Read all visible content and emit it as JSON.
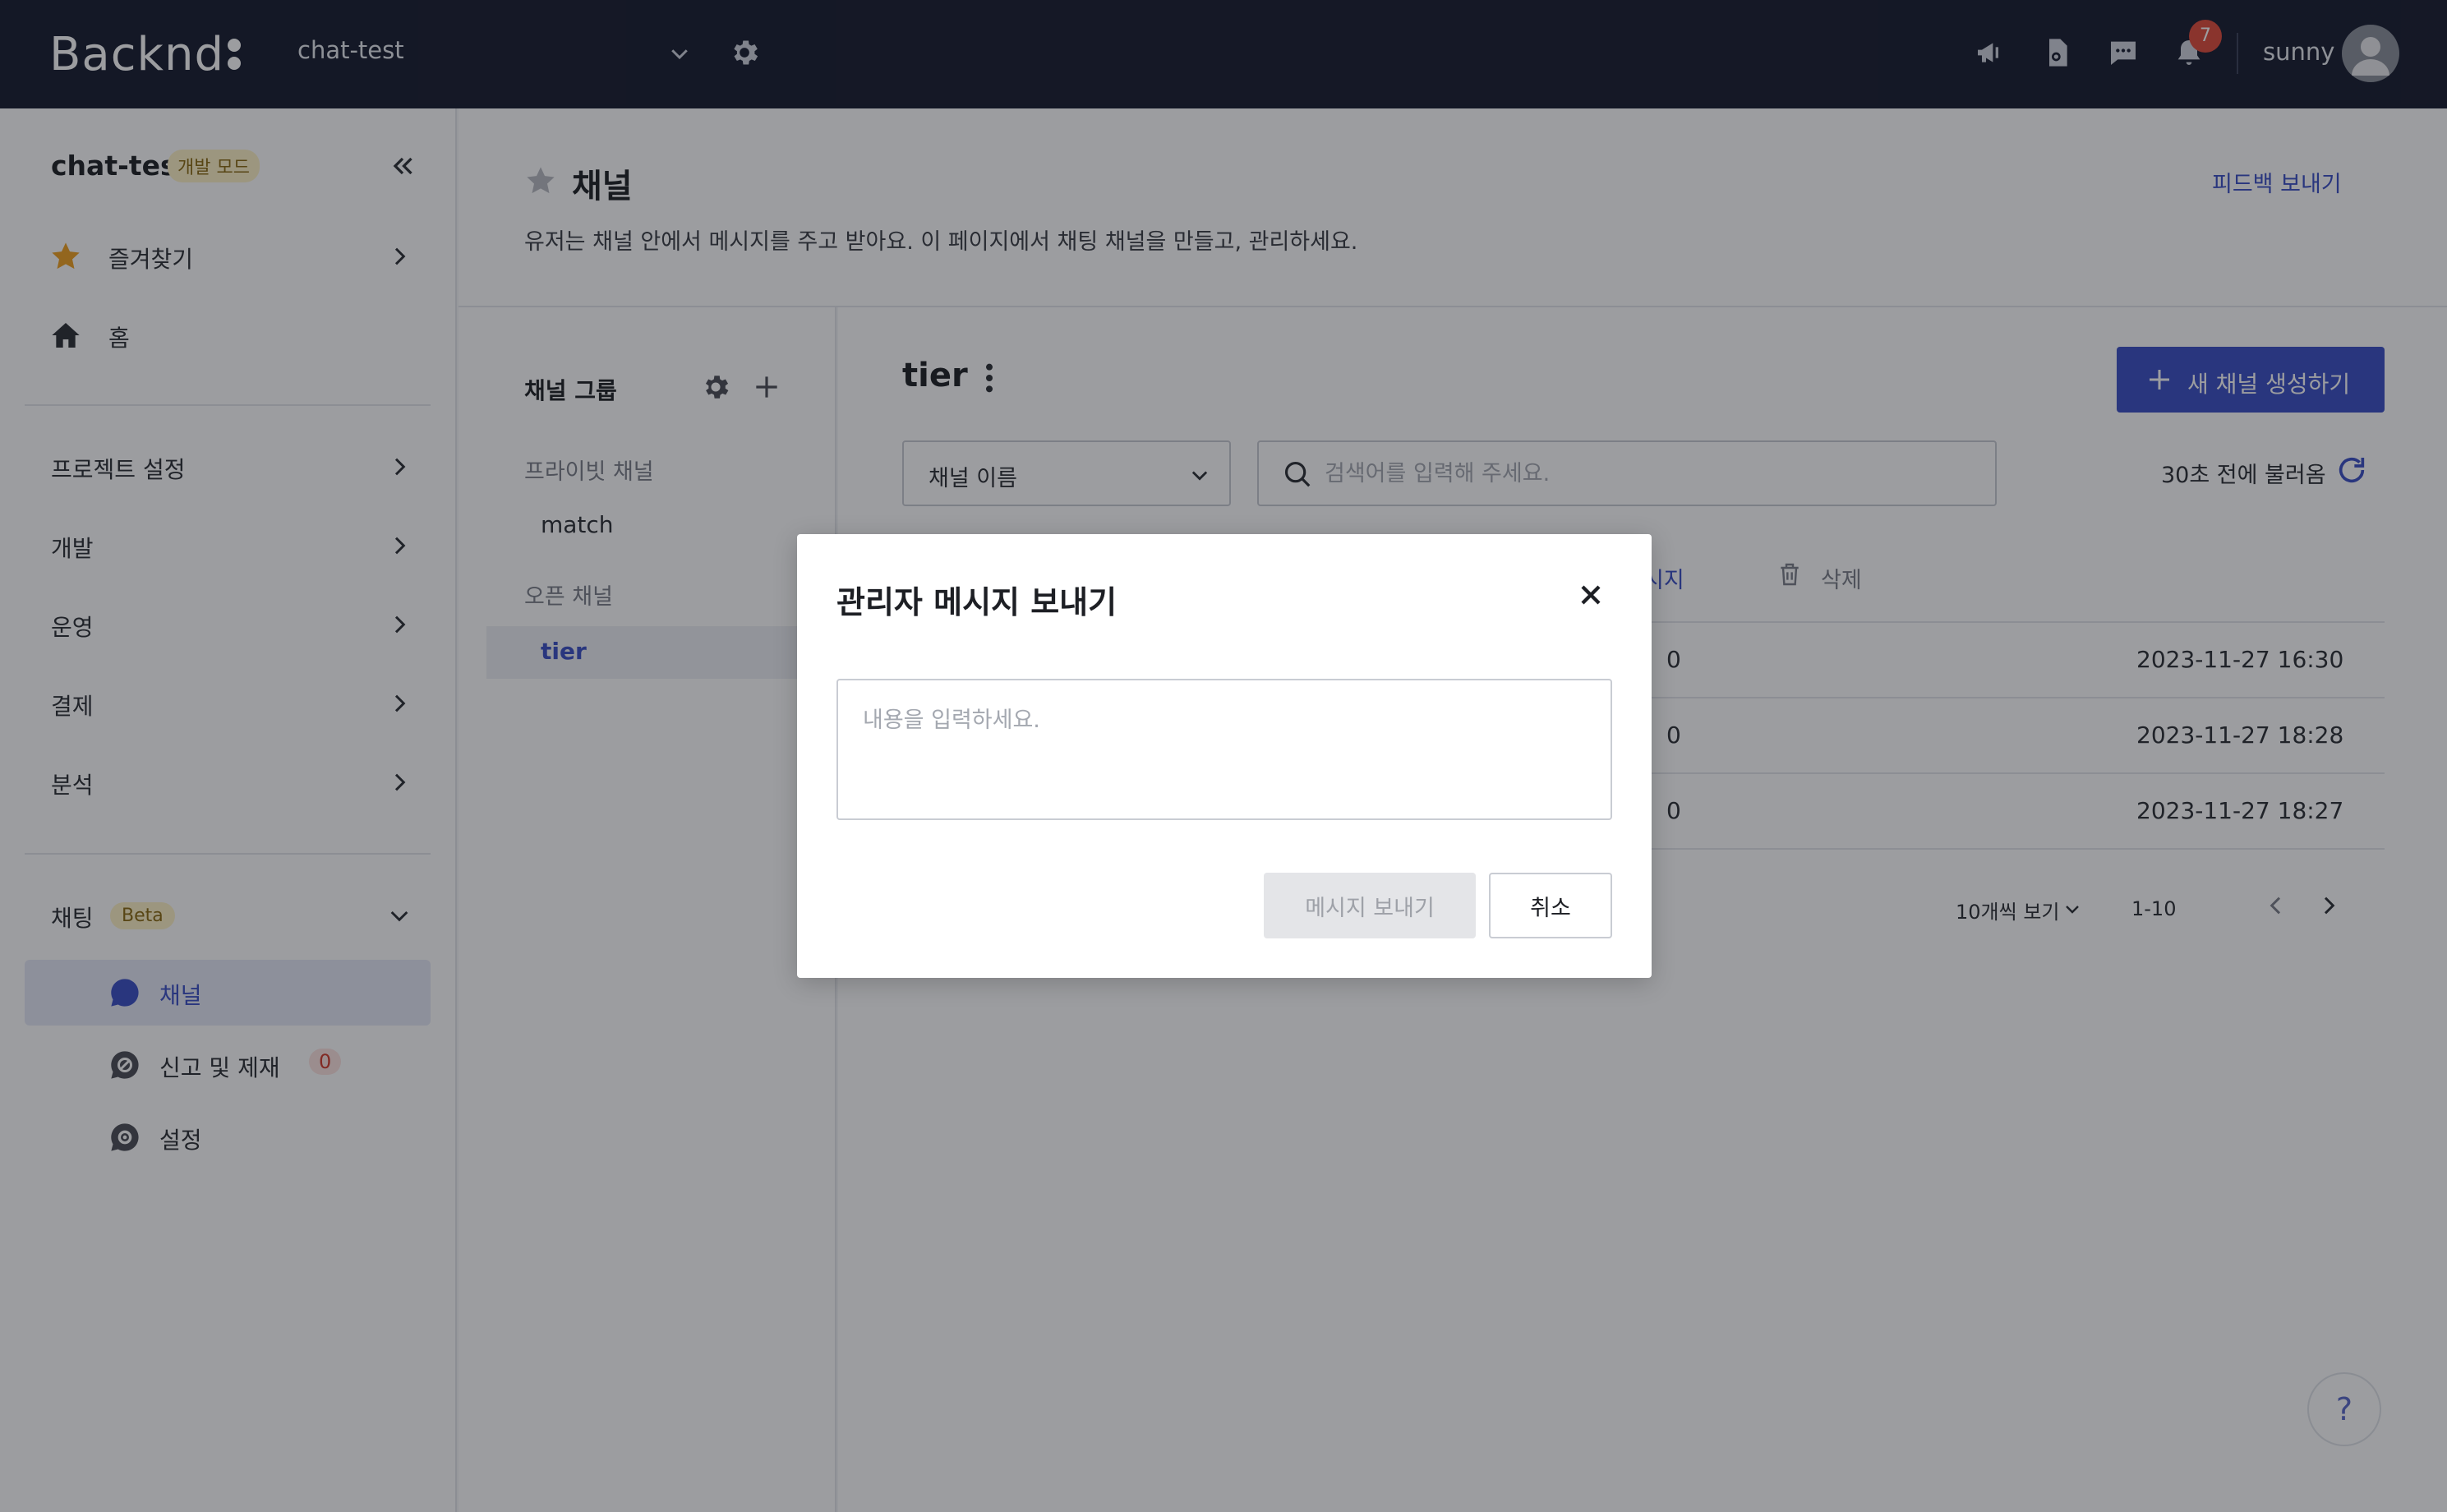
{
  "topbar": {
    "logo": "Backnd",
    "project": "chat-test",
    "notification_count": "7",
    "username": "sunny",
    "icons": [
      "megaphone-icon",
      "document-icon",
      "chat-icon",
      "bell-icon",
      "avatar-icon"
    ]
  },
  "sidebar": {
    "project_name": "chat-test",
    "mode_badge": "개발 모드",
    "favorites": "즐겨찾기",
    "home": "홈",
    "sections": [
      "프로젝트 설정",
      "개발",
      "운영",
      "결제",
      "분석"
    ],
    "chat": {
      "label": "채팅",
      "badge": "Beta"
    },
    "chat_items": [
      {
        "label": "채널",
        "active": true
      },
      {
        "label": "신고 및 제재",
        "count": "0"
      },
      {
        "label": "설정"
      }
    ]
  },
  "header": {
    "title": "채널",
    "description": "유저는 채널 안에서 메시지를 주고 받아요. 이 페이지에서 채팅 채널을 만들고, 관리하세요.",
    "feedback": "피드백 보내기"
  },
  "groups": {
    "title": "채널 그룹",
    "private_label": "프라이빗 채널",
    "private_items": [
      "match"
    ],
    "open_label": "오픈 채널",
    "open_items": [
      "tier"
    ]
  },
  "panel": {
    "title": "tier",
    "new_channel": "새 채널 생성하기",
    "filter_select": "채널 이름",
    "search_placeholder": "검색어를 입력해 주세요.",
    "refreshed": "30초 전에 불러옴",
    "toolbar_message_partial": "시지",
    "toolbar_delete": "삭제",
    "rows": [
      {
        "count_partial": "0",
        "date": "2023-11-27 16:30"
      },
      {
        "count_partial": "0",
        "date": "2023-11-27 18:28"
      },
      {
        "count_partial": "0",
        "date": "2023-11-27 18:27"
      }
    ],
    "per_page": "10개씩 보기",
    "range": "1-10"
  },
  "help": "?",
  "modal": {
    "title": "관리자 메시지 보내기",
    "placeholder": "내용을 입력하세요.",
    "send": "메시지 보내기",
    "cancel": "취소"
  },
  "colors": {
    "topbar": "#151a2d",
    "accent": "#3a4ec4",
    "star": "#f0a020",
    "badge_red": "#e04a3a"
  }
}
